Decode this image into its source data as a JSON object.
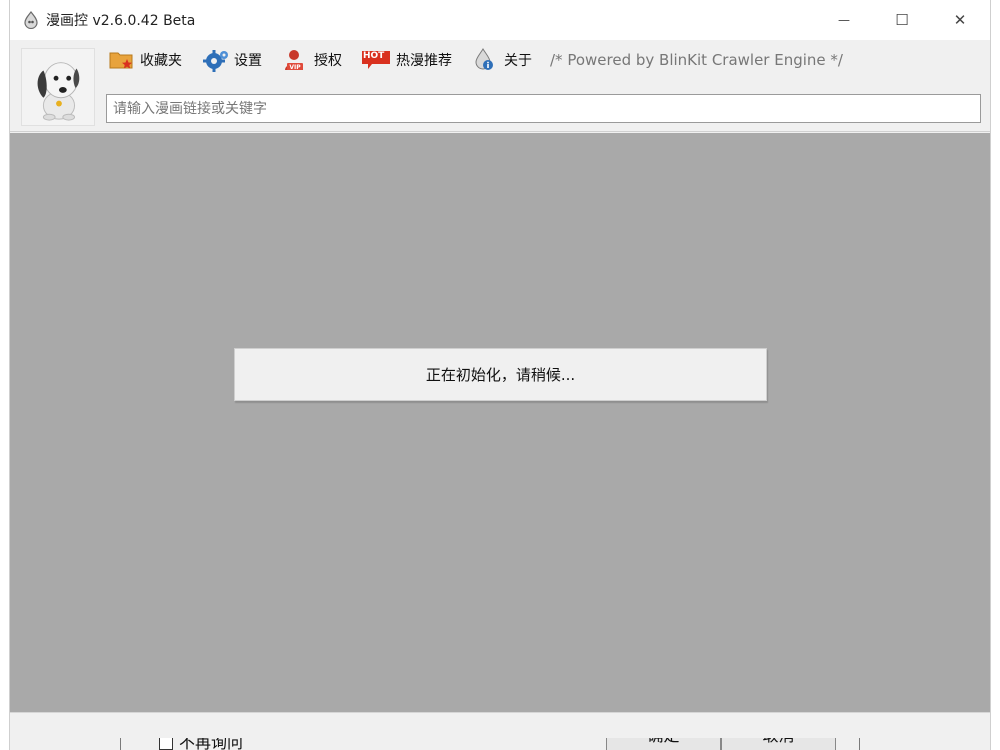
{
  "window": {
    "title": "漫画控 v2.6.0.42 Beta",
    "controls": {
      "minimize": "—",
      "maximize": "☐",
      "close": "✕"
    }
  },
  "toolbar": {
    "items": [
      {
        "label": "收藏夹",
        "icon": "favorites-folder-star-icon"
      },
      {
        "label": "设置",
        "icon": "settings-gear-icon"
      },
      {
        "label": "授权",
        "icon": "vip-user-icon"
      },
      {
        "label": "热漫推荐",
        "icon": "hot-badge-icon",
        "badge": "HOT"
      },
      {
        "label": "关于",
        "icon": "info-drop-icon"
      }
    ],
    "powered_by": "/* Powered by BlinKit Crawler Engine */"
  },
  "search": {
    "placeholder": "请输入漫画链接或关键字",
    "value": ""
  },
  "main": {
    "loading_text": "正在初始化，请稍候..."
  },
  "background_dialog": {
    "checkbox_label": "不再询问",
    "ok_label": "确定",
    "cancel_label": "取消"
  },
  "colors": {
    "content_bg": "#a9a9a9",
    "window_bg": "#f0f0f0",
    "hot_badge": "#d9311f",
    "folder": "#e8a33c",
    "gear": "#2e6fb8"
  }
}
